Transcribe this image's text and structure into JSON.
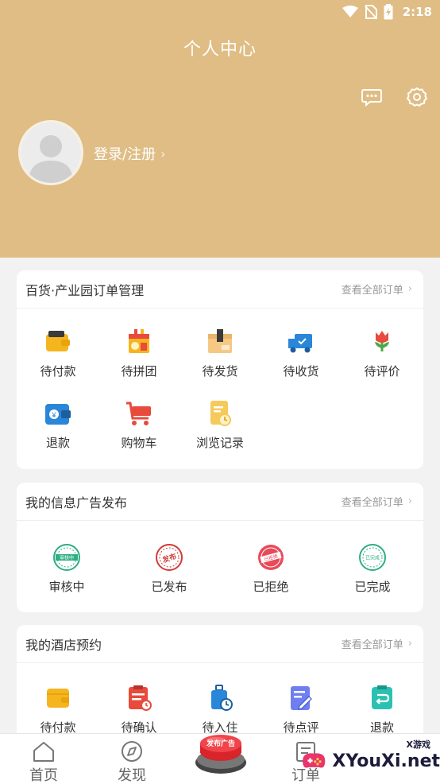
{
  "status_bar": {
    "time": "2:18"
  },
  "header": {
    "title": "个人中心",
    "login_label": "登录/注册",
    "chevron": "›"
  },
  "colors": {
    "header_bg": "#dfbd85",
    "card_bg": "#ffffff",
    "page_bg": "#f2f2f2"
  },
  "orders_card": {
    "title": "百货·产业园订单管理",
    "more_label": "查看全部订单",
    "items": [
      {
        "label": "待付款",
        "icon": "wallet-icon"
      },
      {
        "label": "待拼团",
        "icon": "group-buy-icon"
      },
      {
        "label": "待发货",
        "icon": "package-icon"
      },
      {
        "label": "待收货",
        "icon": "delivery-truck-icon"
      },
      {
        "label": "待评价",
        "icon": "flower-review-icon"
      },
      {
        "label": "退款",
        "icon": "refund-wallet-icon"
      },
      {
        "label": "购物车",
        "icon": "shopping-cart-icon"
      },
      {
        "label": "浏览记录",
        "icon": "history-doc-icon"
      }
    ]
  },
  "ads_card": {
    "title": "我的信息广告发布",
    "more_label": "查看全部订单",
    "items": [
      {
        "label": "审核中",
        "icon": "reviewing-stamp-icon",
        "stamp_text": "审核中"
      },
      {
        "label": "已发布",
        "icon": "published-stamp-icon",
        "stamp_text": "发布"
      },
      {
        "label": "已拒绝",
        "icon": "rejected-stamp-icon",
        "stamp_text": "已拒绝"
      },
      {
        "label": "已完成",
        "icon": "completed-stamp-icon",
        "stamp_text": "已完成"
      }
    ]
  },
  "hotel_card": {
    "title": "我的酒店预约",
    "more_label": "查看全部订单",
    "items": [
      {
        "label": "待付款",
        "icon": "wallet-icon"
      },
      {
        "label": "待确认",
        "icon": "clipboard-clock-icon"
      },
      {
        "label": "待入住",
        "icon": "luggage-clock-icon"
      },
      {
        "label": "待点评",
        "icon": "edit-doc-icon"
      },
      {
        "label": "退款",
        "icon": "refund-clipboard-icon"
      }
    ]
  },
  "bottom_nav": {
    "items": [
      {
        "label": "首页",
        "icon": "home-icon"
      },
      {
        "label": "发现",
        "icon": "compass-icon"
      },
      {
        "label": "订单",
        "icon": "order-icon"
      }
    ],
    "publish_label": "发布广告"
  },
  "watermark": {
    "text": "XYouXi.net",
    "small": "X游戏"
  }
}
